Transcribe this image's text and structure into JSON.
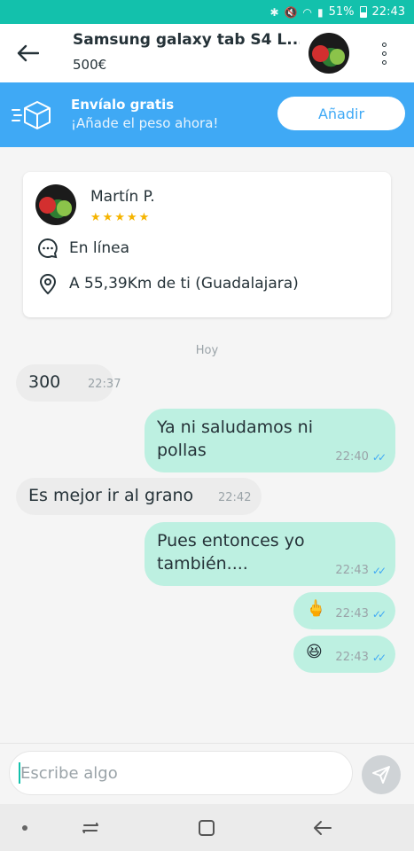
{
  "status_bar": {
    "battery": "51%",
    "time": "22:43"
  },
  "header": {
    "title": "Samsung galaxy tab S4 L...",
    "price": "500€"
  },
  "banner": {
    "title": "Envíalo gratis",
    "subtitle": "¡Añade el peso ahora!",
    "button": "Añadir"
  },
  "seller": {
    "name": "Martín P.",
    "rating_stars": 5,
    "status": "En línea",
    "location": "A 55,39Km de ti (Guadalajara)"
  },
  "chat": {
    "day_label": "Hoy",
    "messages": [
      {
        "direction": "in",
        "text": "300",
        "time": "22:37"
      },
      {
        "direction": "out",
        "text": "Ya ni saludamos ni pollas",
        "time": "22:40"
      },
      {
        "direction": "in",
        "text": "Es mejor ir al grano",
        "time": "22:42"
      },
      {
        "direction": "out",
        "text": "Pues entonces yo también....",
        "time": "22:43"
      },
      {
        "direction": "out",
        "text": "🖕",
        "time": "22:43"
      },
      {
        "direction": "out",
        "text": "😆",
        "time": "22:43"
      }
    ]
  },
  "composer": {
    "placeholder": "Escribe algo"
  },
  "colors": {
    "brand": "#13c1ac",
    "banner": "#3fa9f5",
    "outgoing_bubble": "#bdf0e1",
    "incoming_bubble": "#ececec"
  },
  "icons": [
    "bluetooth-icon",
    "mute-icon",
    "wifi-icon",
    "signal-icon",
    "battery-icon",
    "back-arrow-icon",
    "more-vertical-icon",
    "box-icon",
    "chat-bubble-icon",
    "location-pin-icon",
    "star-icon",
    "send-icon",
    "recents-icon",
    "home-icon",
    "nav-back-icon"
  ]
}
